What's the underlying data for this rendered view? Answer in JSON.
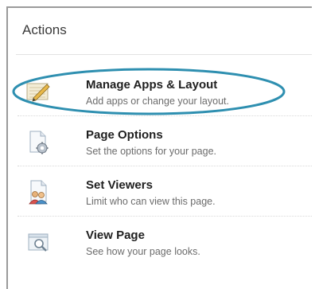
{
  "panel": {
    "title": "Actions",
    "highlight_color": "#2e8fb0",
    "items": [
      {
        "title": "Manage Apps & Layout",
        "description": "Add apps or change your layout.",
        "icon": "layout-pencil-icon",
        "highlighted": true
      },
      {
        "title": "Page Options",
        "description": "Set the options for your page.",
        "icon": "page-settings-icon"
      },
      {
        "title": "Set Viewers",
        "description": "Limit who can view this page.",
        "icon": "page-users-icon"
      },
      {
        "title": "View Page",
        "description": "See how your page looks.",
        "icon": "page-magnifier-icon"
      }
    ]
  }
}
